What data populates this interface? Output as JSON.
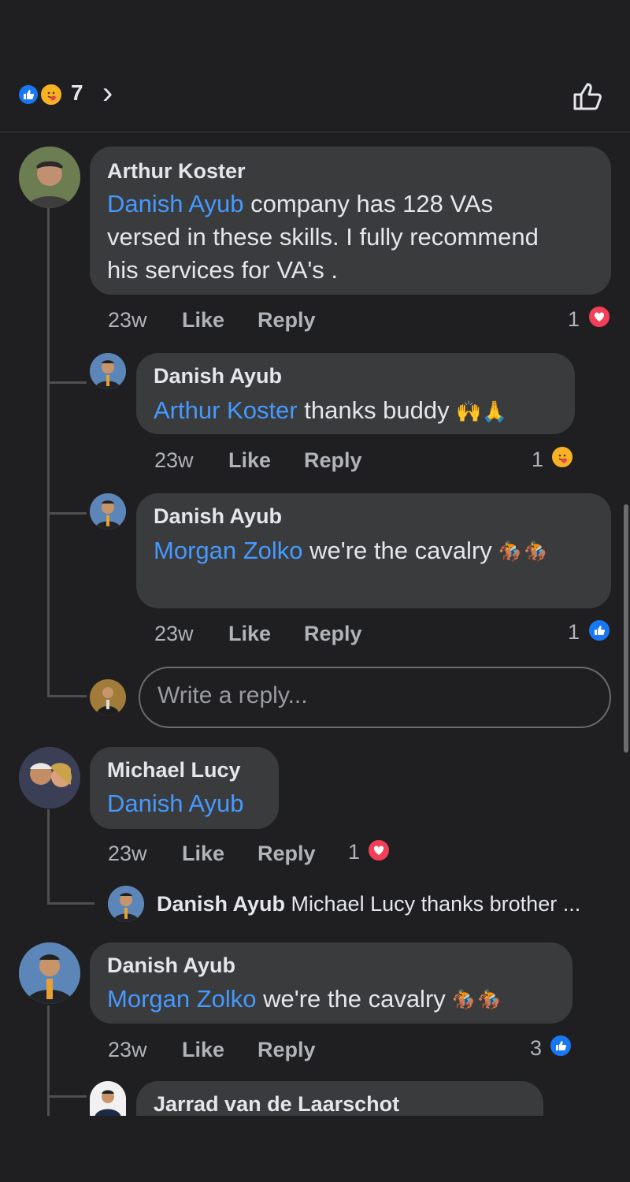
{
  "reactions": {
    "count": "7",
    "chevron": "›",
    "like_icon": "thumbs-up-outline-icon"
  },
  "comments": [
    {
      "author": "Arthur Koster",
      "mention": "Danish Ayub",
      "text_lines": [
        " company has 128 VAs",
        "versed in these skills.  I fully recommend",
        "his services for VA's ."
      ],
      "time": "23w",
      "like": "Like",
      "reply": "Reply",
      "reaction_count": "1",
      "reaction": "love"
    },
    {
      "author": "Danish Ayub",
      "mention": "Arthur Koster",
      "text": " thanks buddy",
      "emojis": "🙌🙏",
      "time": "23w",
      "like": "Like",
      "reply": "Reply",
      "reaction_count": "1",
      "reaction": "care"
    },
    {
      "author": "Danish Ayub",
      "mention": "Morgan Zolko",
      "text": " we're the cavalry",
      "emojis": "🏇🏇",
      "time": "23w",
      "like": "Like",
      "reply": "Reply",
      "reaction_count": "1",
      "reaction": "like"
    },
    {
      "reply_placeholder": "Write a reply..."
    },
    {
      "author": "Michael Lucy",
      "mention": "Danish Ayub",
      "time": "23w",
      "like": "Like",
      "reply": "Reply",
      "reaction_count": "1",
      "reaction": "love"
    },
    {
      "collapsed_author": "Danish Ayub",
      "collapsed_text": "Michael Lucy thanks brother ..."
    },
    {
      "author": "Danish Ayub",
      "mention": "Morgan Zolko",
      "text": " we're the cavalry",
      "emojis": "🏇🏇",
      "time": "23w",
      "like": "Like",
      "reply": "Reply",
      "reaction_count": "3",
      "reaction": "like"
    },
    {
      "author": "Jarrad van de Laarschot"
    }
  ],
  "colors": {
    "background": "#1f1f21",
    "bubble": "#3a3b3c",
    "mention": "#4599ff",
    "like_blue": "#1877f2",
    "love_red": "#f33e58"
  }
}
